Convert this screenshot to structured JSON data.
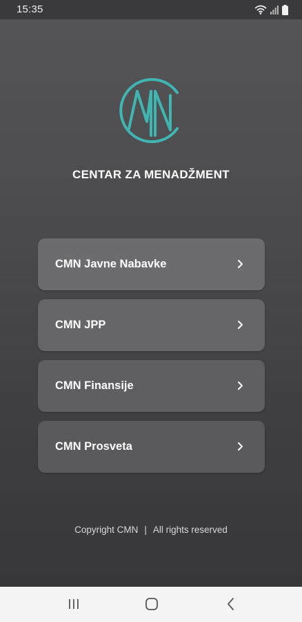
{
  "status_bar": {
    "time": "15:35",
    "icons": [
      "wifi-icon",
      "signal-icon",
      "battery-icon"
    ]
  },
  "app": {
    "title": "CENTAR ZA MENADŽMENT",
    "logo_text": "CMN",
    "accent_color": "#3fb6b2"
  },
  "menu": {
    "items": [
      {
        "label": "CMN Javne Nabavke",
        "icon": "chevron-right-icon"
      },
      {
        "label": "CMN JPP",
        "icon": "chevron-right-icon"
      },
      {
        "label": "CMN Finansije",
        "icon": "chevron-right-icon"
      },
      {
        "label": "CMN Prosveta",
        "icon": "chevron-right-icon"
      }
    ]
  },
  "footer": {
    "copyright": "Copyright CMN",
    "separator": "|",
    "rights": "All rights reserved"
  },
  "nav_bar": {
    "buttons": [
      "recents-icon",
      "home-icon",
      "back-icon"
    ]
  }
}
